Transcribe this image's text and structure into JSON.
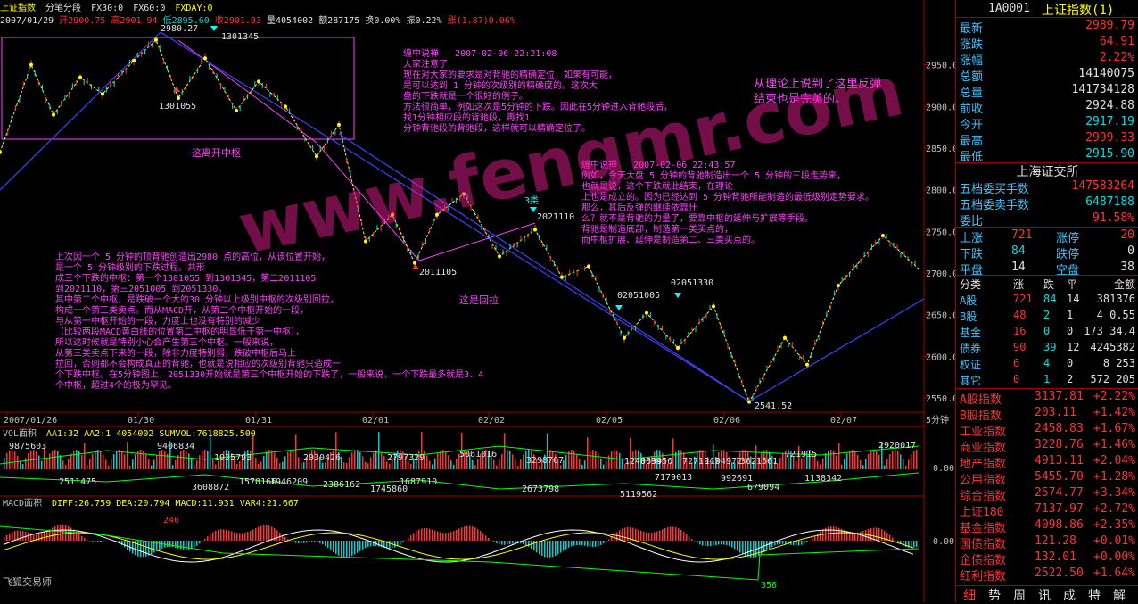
{
  "header": {
    "title": "上证指数",
    "chart_mode": "分笔分段",
    "fx30": "FX30:0",
    "fx60": "FX60:0",
    "fxday": "FXDAY:0",
    "date": "2007/01/29",
    "open": "开2900.75",
    "high": "高2901.94",
    "low": "低2895.60",
    "close": "收2901.93",
    "volume": "量4054002",
    "amount": "额287175",
    "turnover": "换0.00%",
    "amplitude": "振0.22%",
    "change": "涨(1.87)0.06%"
  },
  "chart_data": [
    {
      "type": "line",
      "title": "",
      "x_ticks": [
        "2007/01/26",
        "01/30",
        "01/31",
        "02/01",
        "02/02",
        "02/05",
        "02/06",
        "02/07"
      ],
      "period_label": "5分钟",
      "y_ticks": [
        2950.0,
        2900.0,
        2850.0,
        2800.0,
        2750.0,
        2700.0,
        2650.0,
        2600.0,
        2550.0
      ],
      "ylim": [
        2535,
        2985
      ],
      "series": [
        {
          "x": [
            0,
            35,
            60,
            90,
            115,
            150,
            175,
            200,
            230,
            265,
            290,
            320,
            355,
            380,
            410,
            440,
            465,
            490,
            520,
            560,
            600,
            630,
            660,
            700,
            725,
            760,
            800,
            840,
            880,
            905,
            940,
            990,
            1030
          ],
          "values": [
            2845,
            2950,
            2890,
            2935,
            2915,
            2955,
            2980,
            2910,
            2958,
            2895,
            2930,
            2900,
            2840,
            2878,
            2738,
            2770,
            2712,
            2770,
            2795,
            2720,
            2752,
            2695,
            2708,
            2622,
            2652,
            2610,
            2660,
            2545,
            2622,
            2590,
            2685,
            2745,
            2705
          ]
        }
      ],
      "annotations": [
        "2980.27",
        "1301345",
        "1301055",
        "2011105",
        "2021110",
        "3类",
        "02051005",
        "02051330",
        "2541.52",
        "这离开中枢",
        "这是回拉"
      ]
    },
    {
      "type": "bar",
      "title": "VOL面积",
      "params": [
        "AA1:32",
        "AA2:1",
        "4054002",
        "SUMVOL:7618825.500"
      ],
      "labels": [
        "9875603",
        "2511475",
        "9406834",
        "3608872",
        "1935793",
        "1570166",
        "1946209",
        "2030426",
        "2386162",
        "1745860",
        "2797329",
        "1687910",
        "5061016",
        "2673798",
        "3298767",
        "5119562",
        "809456",
        "7179013",
        "1194972",
        "992691",
        "679094",
        "721915",
        "1138342",
        "2920017",
        "3621561",
        "1240639",
        "7271947"
      ],
      "y_ticks": [
        "0.00"
      ]
    },
    {
      "type": "bar",
      "title": "MACD面积",
      "params": [
        "DIFF:26.759",
        "DEA:20.794",
        "MACD:11.931",
        "VAR4:21.667"
      ],
      "labels": [
        "246",
        "356"
      ],
      "y_ticks": [
        "0.00"
      ]
    }
  ],
  "notes": {
    "note1": "缠中说禅   2007-02-06 22:21:08\n大家注意了\n现在对大家的要求是对背驰的精确定位，如果有可能，\n是可以达到 1 分钟的次级别的精确度的。这次大\n盘的下跌就是一个很好的例子。\n方法很简单，例如这次是5分钟的下跌。因此在5分钟进入背驰段后，\n找1分钟相应段的背驰段，再找1\n分钟背驰段的背驰段，这样就可以精确定位了。",
    "note2": "缠中说禅   2007-02-06 22:43:57\n例如，今天大盘 5 分钟的背驰制造出一个 5 分钟的三段走势来，\n也就是说，这个下跌就此结束，在理论\n上也是成立的。因为已经达到 5 分钟背驰所能制造的最低级别走势要求。\n那么，其后反弹的继续依靠什\n么？就不是背驰的力量了，要靠中枢的延伸与扩展等手段。\n背驰是制造底部，制造第一类买点的，\n而中枢扩展、延伸是制造第二、三类买点的。",
    "note3": "从理论上说到了这里反弹\n结束也是完美的。",
    "note4": "上次因一个 5 分钟的顶背驰创造出2980 点的高位，从该位置开始，\n是一个 5 分钟级别的下跌过程。共形\n成三个下跌的中枢：第一个1301055 到1301345，第二2011105\n到2021110，第三2051005 到2051330。\n其中第二个中枢，是跌破一个大的30 分钟以上级别中枢的次级别回拉，\n构成一个第三类卖点。而从MACD开，从第二个中枢开始的一段，\n与从第一中枢开始的一段，力度上也没有特别的减少\n（比较两段MACD黄白线的位置第二中枢的明显低于第一中枢），\n所以这时候就是特别小心会产生第三个中枢。一般来说，\n从第三类卖点下来的一段，除非力度特别弱，跌破中枢后马上\n拉回，否则都不会构成真正的背驰，也就是说相应的次级别背驰只造成一\n个下跌中枢。在5分钟图上，2051330开始就是第三个中枢开始的下跌了，一般来说，一个下跌最多就是3、4\n个中枢，超过4个的极为罕见。"
  },
  "watermark": "www.fengmr.com",
  "footer_label": "飞狐交易师",
  "panel": {
    "code": "1A0001",
    "name": "上证指数(1)",
    "quote": [
      {
        "label": "最新",
        "value": "2989.79",
        "color": "#ff3333"
      },
      {
        "label": "涨跌",
        "value": "64.91",
        "color": "#ff3333"
      },
      {
        "label": "涨幅",
        "value": "2.22%",
        "color": "#ff3333"
      },
      {
        "label": "总额",
        "value": "14140075",
        "color": "#e0e0e0"
      },
      {
        "label": "总量",
        "value": "141734128",
        "color": "#e0e0e0"
      },
      {
        "label": "前收",
        "value": "2924.88",
        "color": "#e0e0e0"
      },
      {
        "label": "今开",
        "value": "2917.19",
        "color": "#00e0e0"
      },
      {
        "label": "最高",
        "value": "2999.33",
        "color": "#ff3333"
      },
      {
        "label": "最低",
        "value": "2915.90",
        "color": "#00e0e0"
      }
    ],
    "exchange": "上海证交所",
    "depth": [
      {
        "label": "五档委买手数",
        "value": "147583264",
        "color": "#ff3333"
      },
      {
        "label": "五档委卖手数",
        "value": "6487188",
        "color": "#00e0e0"
      },
      {
        "label": "委比",
        "value": "91.58%",
        "color": "#ff3333"
      }
    ],
    "updown": [
      {
        "l1": "上涨",
        "v1": "721",
        "l2": "涨停",
        "v2": "20"
      },
      {
        "l1": "下跌",
        "v1": "84",
        "l2": "跌停",
        "v2": "0"
      },
      {
        "l1": "平盘",
        "v1": "14",
        "l2": "空盘",
        "v2": "38"
      }
    ],
    "table_header": [
      "分类",
      "涨",
      "跌",
      "平",
      "金额"
    ],
    "table_rows": [
      [
        "A股",
        "721",
        "84",
        "14",
        "381376"
      ],
      [
        "B股",
        "48",
        "2",
        "1",
        "4 0.55"
      ],
      [
        "基金",
        "16",
        "0",
        "0",
        "173 34.4"
      ],
      [
        "债券",
        "90",
        "39",
        "12",
        "4245382"
      ],
      [
        "权证",
        "6",
        "4",
        "0",
        "8 253"
      ],
      [
        "其它",
        "0",
        "1",
        "2",
        "572 205"
      ]
    ],
    "indices": [
      {
        "name": "A股指数",
        "value": "3137.81",
        "change": "+2.22%"
      },
      {
        "name": "B股指数",
        "value": "203.11",
        "change": "+1.42%"
      },
      {
        "name": "工业指数",
        "value": "2458.83",
        "change": "+1.67%"
      },
      {
        "name": "商业指数",
        "value": "3228.76",
        "change": "+1.46%"
      },
      {
        "name": "地产指数",
        "value": "4913.11",
        "change": "+2.04%"
      },
      {
        "name": "公用指数",
        "value": "5455.70",
        "change": "+1.28%"
      },
      {
        "name": "综合指数",
        "value": "2574.77",
        "change": "+3.34%"
      },
      {
        "name": "上证180",
        "value": "7137.97",
        "change": "+2.72%"
      },
      {
        "name": "基金指数",
        "value": "4098.86",
        "change": "+2.35%"
      },
      {
        "name": "国债指数",
        "value": "121.28",
        "change": "+0.01%"
      },
      {
        "name": "企债指数",
        "value": "132.01",
        "change": "+0.00%"
      },
      {
        "name": "红利指数",
        "value": "2522.50",
        "change": "+1.64%"
      }
    ],
    "tabs": [
      "细",
      "势",
      "周",
      "讯",
      "成",
      "特",
      "解"
    ]
  }
}
